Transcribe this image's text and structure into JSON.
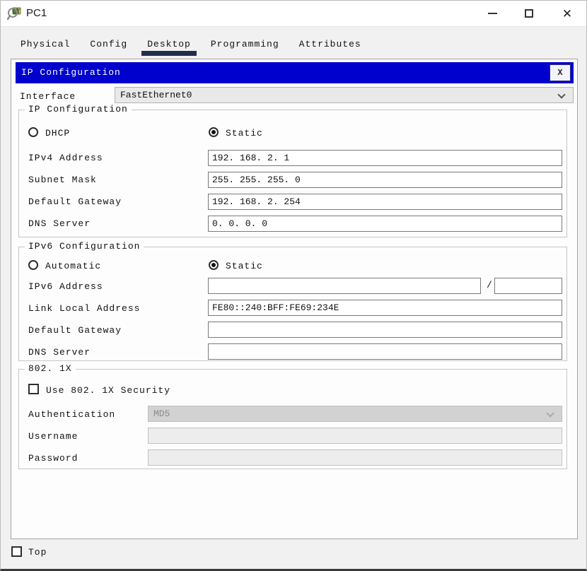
{
  "window": {
    "title": "PC1",
    "close_glyph": "✕"
  },
  "tabs": [
    {
      "label": "Physical",
      "active": false
    },
    {
      "label": "Config",
      "active": false
    },
    {
      "label": "Desktop",
      "active": true
    },
    {
      "label": "Programming",
      "active": false
    },
    {
      "label": "Attributes",
      "active": false
    }
  ],
  "dialog": {
    "title": "IP Configuration",
    "close_label": "X",
    "interface": {
      "label": "Interface",
      "value": "FastEthernet0"
    },
    "ip": {
      "legend": "IP Configuration",
      "dhcp_label": "DHCP",
      "static_label": "Static",
      "dhcp_checked": false,
      "static_checked": true,
      "rows": [
        {
          "label": "IPv4 Address",
          "value": "192. 168. 2. 1"
        },
        {
          "label": "Subnet Mask",
          "value": "255. 255. 255. 0"
        },
        {
          "label": "Default Gateway",
          "value": "192. 168. 2. 254"
        },
        {
          "label": "DNS Server",
          "value": "0. 0. 0. 0"
        }
      ]
    },
    "ipv6": {
      "legend": "IPv6 Configuration",
      "auto_label": "Automatic",
      "static_label": "Static",
      "auto_checked": false,
      "static_checked": true,
      "address_label": "IPv6 Address",
      "address_value": "",
      "separator": "/",
      "prefix_value": "",
      "rows": [
        {
          "label": "Link Local Address",
          "value": "FE80::240:BFF:FE69:234E"
        },
        {
          "label": "Default Gateway",
          "value": ""
        },
        {
          "label": "DNS Server",
          "value": ""
        }
      ]
    },
    "dot1x": {
      "legend": "802. 1X",
      "checkbox_label": "Use 802. 1X Security",
      "use_checked": false,
      "auth_label": "Authentication",
      "auth_value": "MD5",
      "username_label": "Username",
      "username_value": "",
      "password_label": "Password",
      "password_value": ""
    }
  },
  "footer": {
    "top_label": "Top",
    "top_checked": false
  },
  "colors": {
    "dialog_header": "#0101ce",
    "tab_underline": "#232d4b",
    "titlebar_bg": "#ffffff",
    "window_bg": "#f1f1f1",
    "disabled_bg": "#d2d2d2"
  }
}
